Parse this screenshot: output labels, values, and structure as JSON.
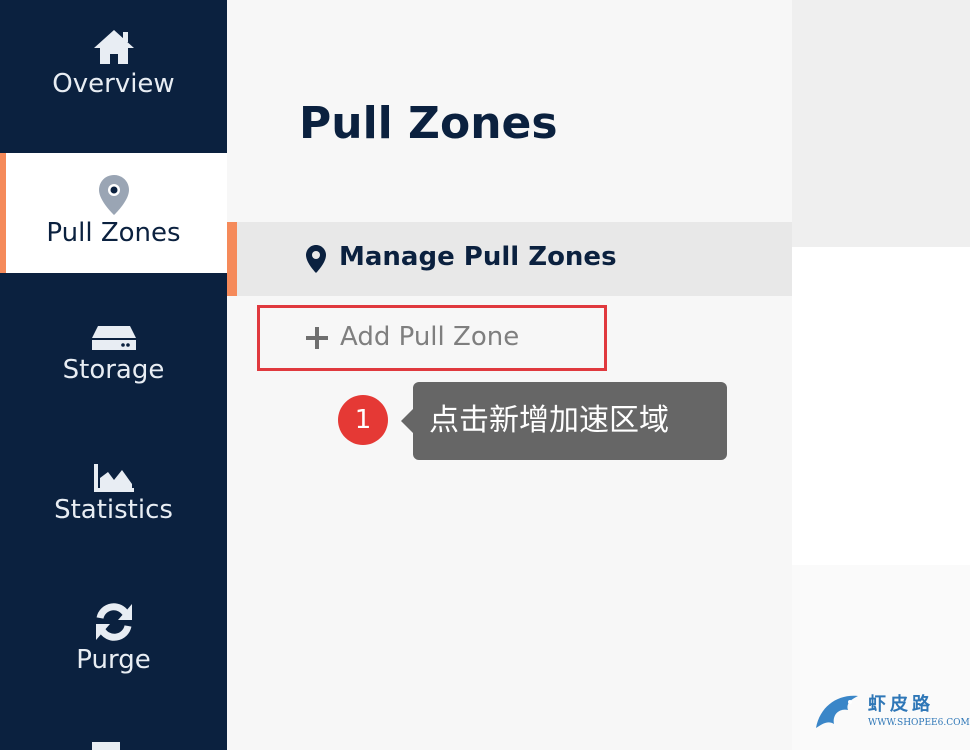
{
  "sidebar": {
    "items": [
      {
        "label": "Overview",
        "icon": "home-icon"
      },
      {
        "label": "Pull Zones",
        "icon": "location-pin-icon",
        "active": true
      },
      {
        "label": "Storage",
        "icon": "hard-drive-icon"
      },
      {
        "label": "Statistics",
        "icon": "area-chart-icon"
      },
      {
        "label": "Purge",
        "icon": "refresh-icon"
      }
    ]
  },
  "panel": {
    "title": "Pull Zones",
    "manage_label": "Manage Pull Zones",
    "add_label": "Add Pull Zone"
  },
  "annotation": {
    "step": "1",
    "text": "点击新增加速区域"
  },
  "watermark": {
    "title": "虾皮路",
    "url": "WWW.SHOPEE6.COM"
  },
  "colors": {
    "sidebar_bg": "#0b213f",
    "accent": "#f58a5a",
    "highlight_border": "#e0393e",
    "tooltip_bg": "#666666"
  }
}
